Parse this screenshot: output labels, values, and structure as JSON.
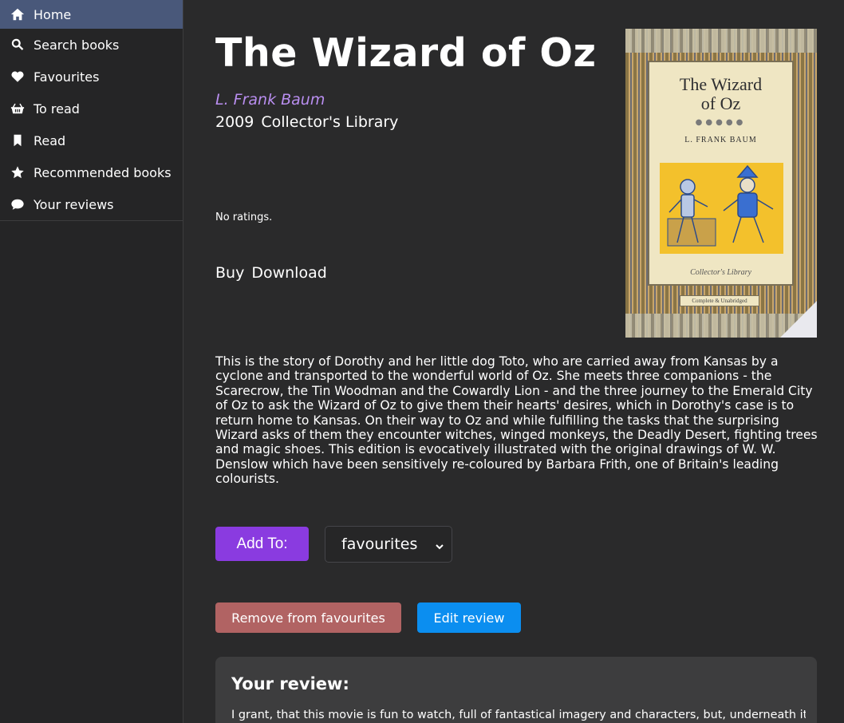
{
  "sidebar": {
    "items": [
      {
        "label": "Home",
        "icon": "home-icon"
      },
      {
        "label": "Search books",
        "icon": "search-icon"
      },
      {
        "label": "Favourites",
        "icon": "heart-icon"
      },
      {
        "label": "To read",
        "icon": "basket-icon"
      },
      {
        "label": "Read",
        "icon": "bookmark-icon"
      },
      {
        "label": "Recommended books",
        "icon": "star-icon"
      },
      {
        "label": "Your reviews",
        "icon": "comment-icon"
      }
    ],
    "active_index": 0
  },
  "book": {
    "title": "The Wizard of Oz",
    "author": "L. Frank Baum",
    "year": "2009",
    "publisher": "Collector's Library",
    "ratings": "No ratings.",
    "buy_label": "Buy",
    "download_label": "Download",
    "description": "This is the story of Dorothy and her little dog Toto, who are carried away from Kansas by a cyclone and transported to the wonderful world of Oz. She meets three companions - the Scarecrow, the Tin Woodman and the Cowardly Lion - and the three journey to the Emerald City of Oz to ask the Wizard of Oz to give them their hearts' desires, which in Dorothy's case is to return home to Kansas. On their way to Oz and while fulfilling the tasks that the surprising Wizard asks of them they encounter witches, winged monkeys, the Deadly Desert, fighting trees and magic shoes. This edition is evocatively illustrated with the original drawings of W. W. Denslow which have been sensitively re-coloured by Barbara Frith, one of Britain's leading colourists."
  },
  "cover": {
    "title_line1": "The Wizard",
    "title_line2": "of Oz",
    "author": "L. FRANK BAUM",
    "series": "Collector's Library",
    "tag": "Complete & Unabridged"
  },
  "actions": {
    "add_to_label": "Add To:",
    "list_select_value": "favourites",
    "remove_label": "Remove from favourites",
    "edit_review_label": "Edit review"
  },
  "review": {
    "heading": "Your review:",
    "text": "I grant, that this movie is fun to watch, full of fantastical imagery and characters, but, underneath it"
  },
  "colors": {
    "background": "#2a2a2b",
    "sidebar_active": "#49587a",
    "author": "#b98ef0",
    "add_button": "#8a3be0",
    "remove_button": "#b16363",
    "edit_button": "#0b8ef0",
    "review_card": "#3d3d3e"
  }
}
